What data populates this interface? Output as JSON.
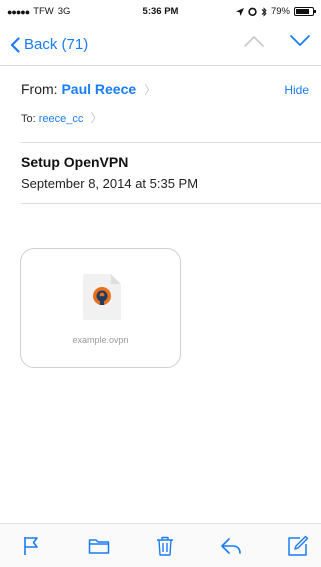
{
  "status_bar": {
    "carrier": "TFW",
    "network": "3G",
    "time": "5:36 PM",
    "battery_percent": "79%",
    "battery_level": 0.79
  },
  "nav": {
    "back_label": "Back (71)"
  },
  "header": {
    "from_label": "From:",
    "from_name": "Paul Reece",
    "hide_label": "Hide",
    "to_label": "To:",
    "to_name": "reece_cc"
  },
  "message": {
    "subject": "Setup OpenVPN",
    "date": "September 8, 2014 at 5:35 PM"
  },
  "attachment": {
    "filename": "example.ovpn",
    "icon": "openvpn-icon"
  },
  "toolbar": {
    "icons": [
      "flag-icon",
      "folder-icon",
      "trash-icon",
      "reply-icon",
      "compose-icon"
    ]
  },
  "colors": {
    "accent": "#1a7cf5",
    "openvpn_orange": "#e8701a",
    "openvpn_navy": "#1f3a63"
  }
}
